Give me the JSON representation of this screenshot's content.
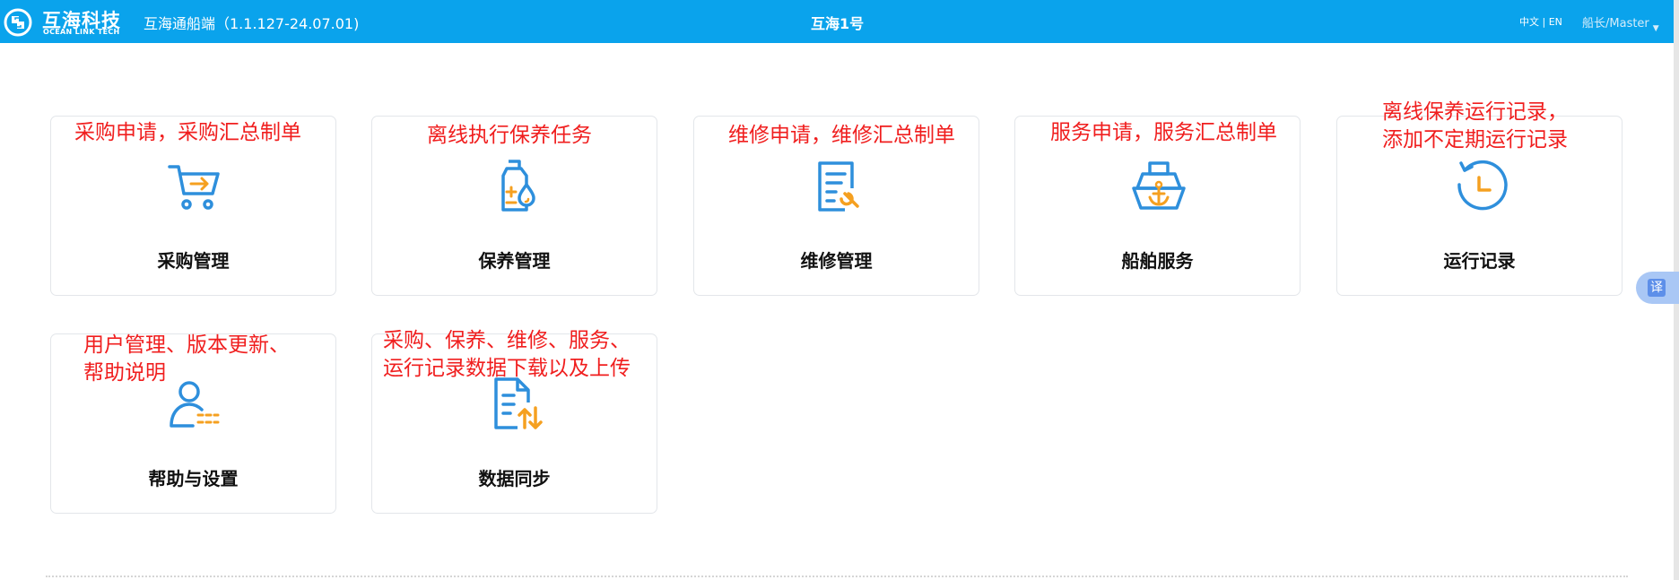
{
  "header": {
    "brand_cn": "互海科技",
    "brand_en": "OCEAN LINK TECH",
    "app_title": "互海通船端（1.1.127-24.07.01)",
    "ship_name": "互海1号",
    "lang_switch": "中文 | EN",
    "user": "船长/Master",
    "user_caret": "▼"
  },
  "modules": [
    {
      "label": "采购管理",
      "icon": "shopping-cart-icon",
      "note": "采购申请，采购汇总制单"
    },
    {
      "label": "保养管理",
      "icon": "oil-bottle-icon",
      "note": "离线执行保养任务"
    },
    {
      "label": "维修管理",
      "icon": "document-wrench-icon",
      "note": "维修申请，维修汇总制单"
    },
    {
      "label": "船舶服务",
      "icon": "ship-anchor-icon",
      "note": "服务申请，服务汇总制单"
    },
    {
      "label": "运行记录",
      "icon": "clock-history-icon",
      "note": [
        "离线保养运行记录，",
        "添加不定期运行记录"
      ]
    },
    {
      "label": "帮助与设置",
      "icon": "user-settings-icon",
      "note": [
        "用户管理、版本更新、",
        "帮助说明"
      ]
    },
    {
      "label": "数据同步",
      "icon": "document-sync-icon",
      "note": [
        "采购、保养、维修、服务、",
        "运行记录数据下载以及上传"
      ]
    }
  ],
  "translate_button": "译",
  "colors": {
    "header_bg": "#0aa3ec",
    "icon_blue": "#2e8fdc",
    "icon_orange": "#f5a020",
    "note_red": "#f01e1e"
  }
}
